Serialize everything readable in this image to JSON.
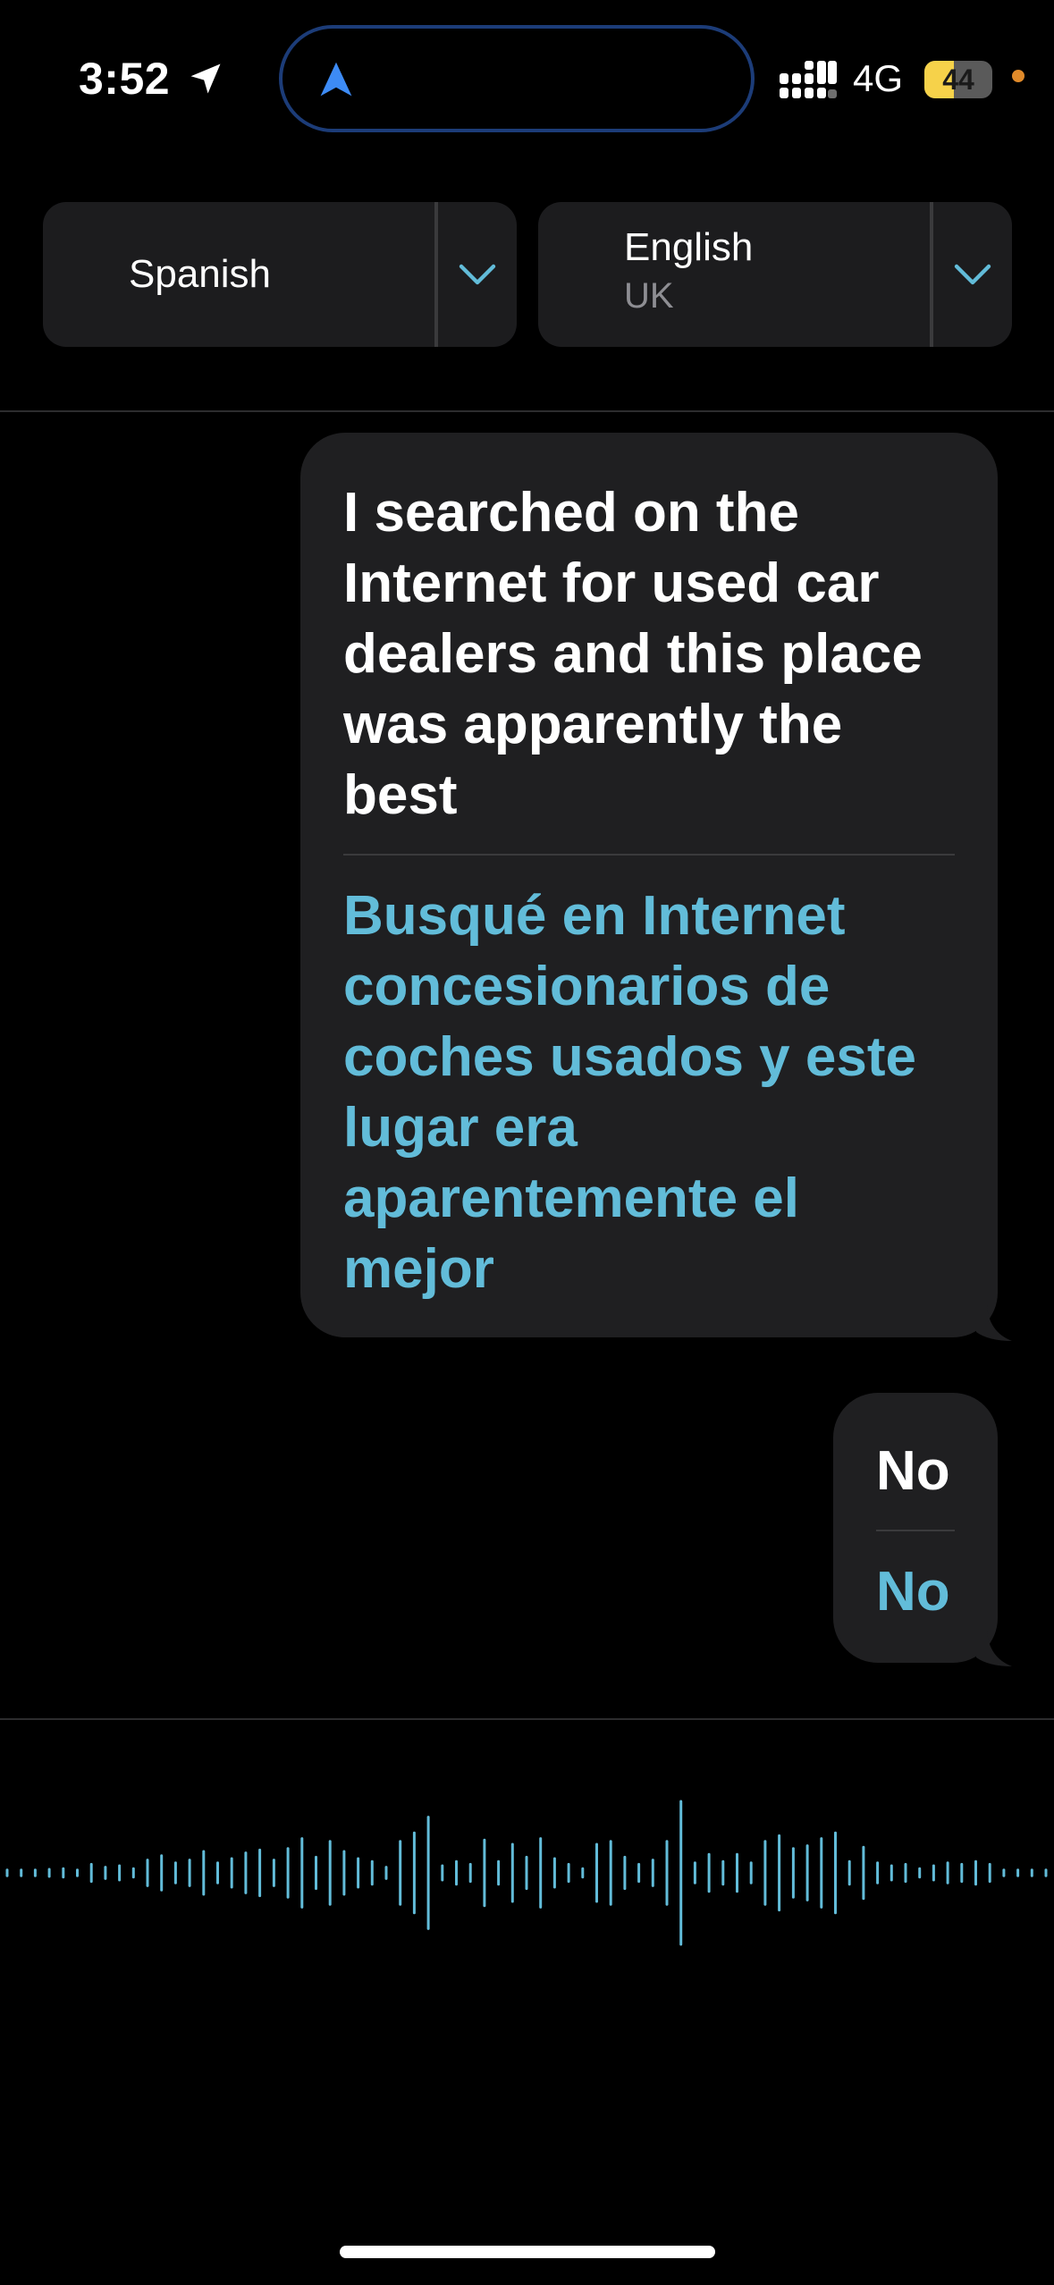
{
  "status_bar": {
    "time": "3:52",
    "network": "4G",
    "battery_percent": 44,
    "battery_label": "44",
    "icons": [
      "location-arrow-icon",
      "navigation-icon",
      "cellular-signal-icon",
      "battery-icon",
      "recording-dot-icon"
    ]
  },
  "languages": {
    "source": {
      "name": "Spanish",
      "icon": "chevron-down-icon"
    },
    "target": {
      "name": "English",
      "region": "UK",
      "icon": "chevron-down-icon"
    }
  },
  "conversation": [
    {
      "original": "I searched on the Internet for used car dealers and this place was apparently the best",
      "translation": "Busqué en Internet concesionarios de coches usados y este lugar era aparentemente el mejor"
    },
    {
      "original": "No",
      "translation": "No"
    }
  ],
  "waveform": {
    "icon": "audio-waveform-icon",
    "levels": [
      0.04,
      0.04,
      0.04,
      0.05,
      0.06,
      0.04,
      0.12,
      0.08,
      0.1,
      0.06,
      0.18,
      0.24,
      0.14,
      0.18,
      0.3,
      0.14,
      0.2,
      0.28,
      0.32,
      0.18,
      0.34,
      0.48,
      0.22,
      0.44,
      0.3,
      0.2,
      0.16,
      0.08,
      0.44,
      0.56,
      0.78,
      0.1,
      0.16,
      0.12,
      0.46,
      0.16,
      0.4,
      0.22,
      0.48,
      0.2,
      0.12,
      0.06,
      0.4,
      0.44,
      0.22,
      0.12,
      0.18,
      0.44,
      1.0,
      0.14,
      0.26,
      0.16,
      0.26,
      0.14,
      0.44,
      0.52,
      0.34,
      0.38,
      0.48,
      0.56,
      0.16,
      0.36,
      0.14,
      0.1,
      0.12,
      0.06,
      0.1,
      0.14,
      0.12,
      0.16,
      0.12,
      0.04,
      0.04,
      0.04,
      0.04
    ],
    "accent_color": "#62bcd9"
  },
  "colors": {
    "background": "#000000",
    "bubble": "#1f1f21",
    "accent": "#62bcd9",
    "island_border": "#1c3c78",
    "battery": "#f6d24a",
    "recording_dot": "#e08a2a"
  }
}
